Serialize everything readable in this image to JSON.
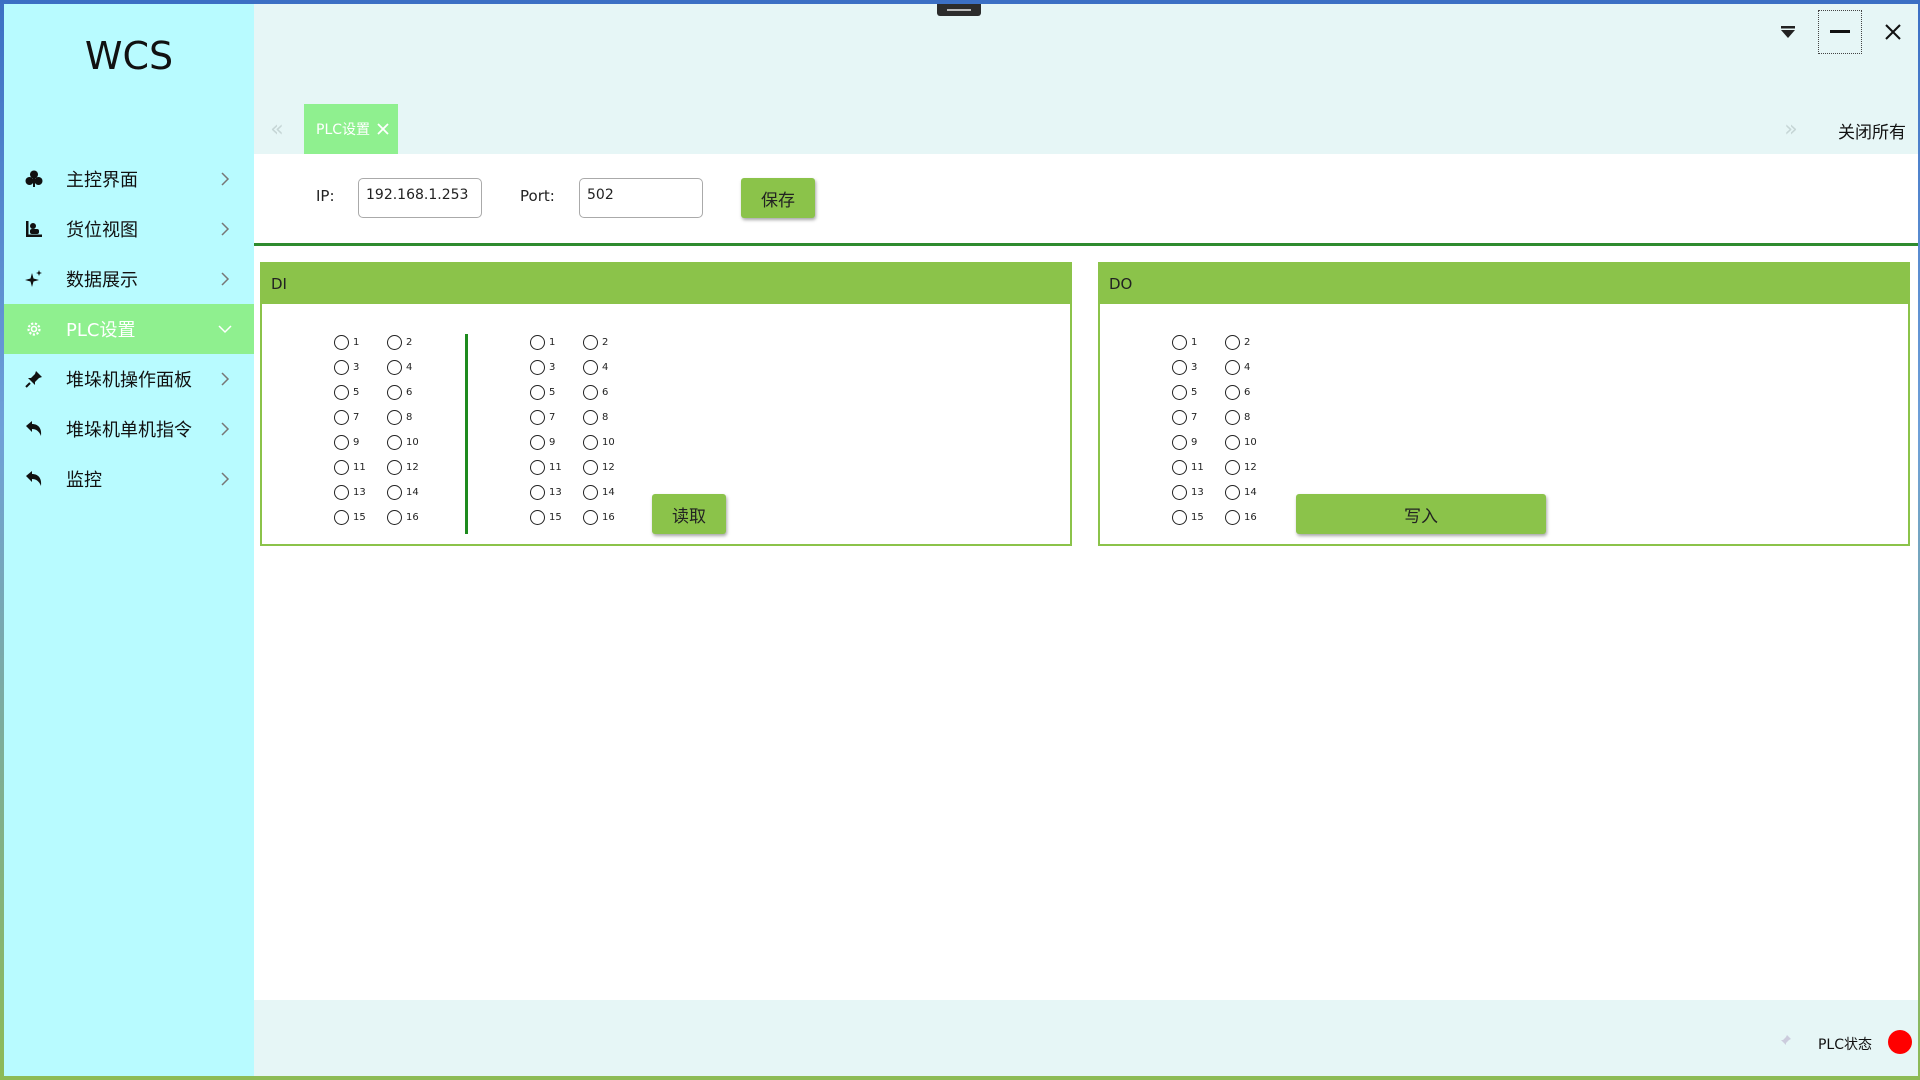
{
  "app": {
    "title": "WCS"
  },
  "sidebar": {
    "items": [
      {
        "label": "主控界面",
        "icon": "dashboard-icon",
        "active": false
      },
      {
        "label": "货位视图",
        "icon": "storage-view-icon",
        "active": false
      },
      {
        "label": "数据展示",
        "icon": "sparkle-icon",
        "active": false
      },
      {
        "label": "PLC设置",
        "icon": "gear-icon",
        "active": true
      },
      {
        "label": "堆垛机操作面板",
        "icon": "pin-icon",
        "active": false
      },
      {
        "label": "堆垛机单机指令",
        "icon": "undo-arrow-icon",
        "active": false
      },
      {
        "label": "监控",
        "icon": "undo-arrow-icon",
        "active": false
      }
    ]
  },
  "tabs": {
    "items": [
      {
        "label": "PLC设置"
      }
    ],
    "close_all": "关闭所有"
  },
  "connection": {
    "ip_label": "IP:",
    "ip_value": "192.168.1.253",
    "port_label": "Port:",
    "port_value": "502",
    "save_label": "保存"
  },
  "di_panel": {
    "title": "DI",
    "group1": [
      "1",
      "2",
      "3",
      "4",
      "5",
      "6",
      "7",
      "8",
      "9",
      "10",
      "11",
      "12",
      "13",
      "14",
      "15",
      "16"
    ],
    "group2": [
      "1",
      "2",
      "3",
      "4",
      "5",
      "6",
      "7",
      "8",
      "9",
      "10",
      "11",
      "12",
      "13",
      "14",
      "15",
      "16"
    ],
    "read_label": "读取"
  },
  "do_panel": {
    "title": "DO",
    "group1": [
      "1",
      "2",
      "3",
      "4",
      "5",
      "6",
      "7",
      "8",
      "9",
      "10",
      "11",
      "12",
      "13",
      "14",
      "15",
      "16"
    ],
    "write_label": "写入"
  },
  "status": {
    "plc_label": "PLC状态",
    "plc_indicator_color": "#ff0000"
  },
  "colors": {
    "sidebar_bg": "#b8fbff",
    "active_green": "#8ff08f",
    "panel_green": "#8bc34a",
    "divider_green": "#2e8b2e"
  }
}
